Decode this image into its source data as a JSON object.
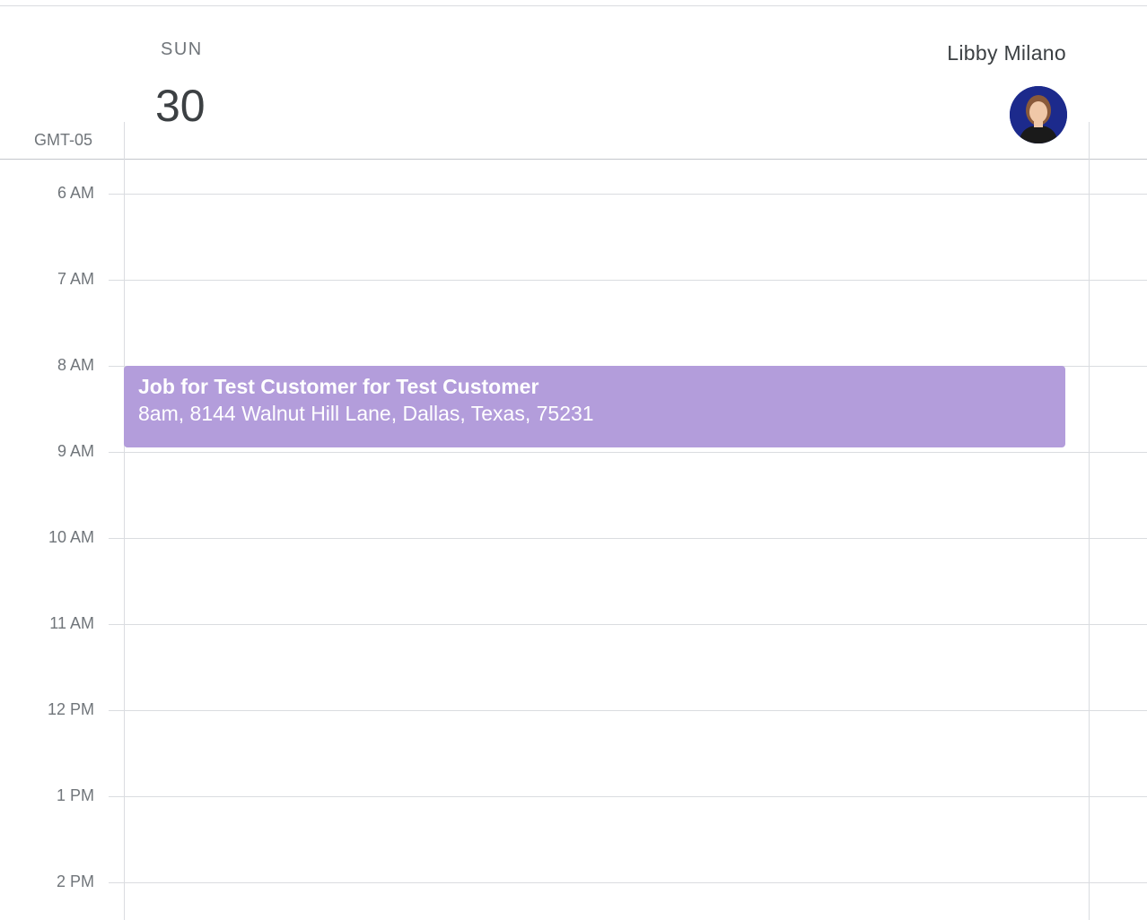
{
  "day": {
    "name": "SUN",
    "number": "30"
  },
  "person": {
    "name": "Libby Milano",
    "avatar_icon": "user-avatar"
  },
  "timezone": "GMT-05",
  "hours": [
    "6 AM",
    "7 AM",
    "8 AM",
    "9 AM",
    "10 AM",
    "11 AM",
    "12 PM",
    "1 PM",
    "2 PM"
  ],
  "event": {
    "title": "Job for Test Customer for Test Customer",
    "detail": "8am, 8144 Walnut Hill Lane, Dallas, Texas, 75231",
    "color": "#b39ddb"
  }
}
